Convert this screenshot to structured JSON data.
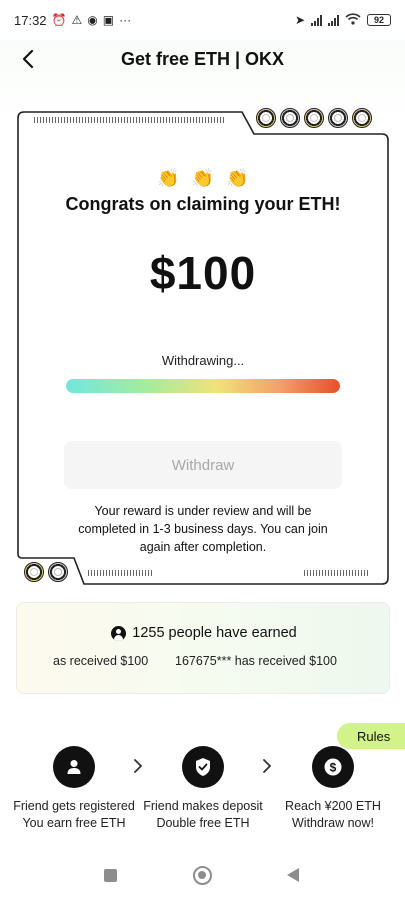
{
  "status_bar": {
    "time": "17:32",
    "icons_left": [
      "alarm-icon",
      "triangle-a-icon",
      "messenger-icon",
      "box-icon",
      "more-dots-icon"
    ],
    "battery": "92"
  },
  "header": {
    "title": "Get free ETH | OKX",
    "back_icon": "chevron-left-icon"
  },
  "card": {
    "claps": [
      "clap-icon",
      "clap-icon",
      "clap-icon"
    ],
    "congrats": "Congrats on claiming your ETH!",
    "amount": "$100",
    "withdrawing_label": "Withdrawing...",
    "progress": 1.0,
    "withdraw_button": "Withdraw",
    "review_text": "Your reward is under review and will be completed in 1-3 business days. You can join again after completion."
  },
  "earned": {
    "headline": "1255 people have earned",
    "ticker": [
      "as received $100",
      "167675*** has received $100"
    ]
  },
  "rules_label": "Rules",
  "steps": [
    {
      "icon": "user-icon",
      "text": "Friend gets registered You earn free ETH"
    },
    {
      "icon": "shield-check-icon",
      "text": "Friend makes deposit Double free ETH"
    },
    {
      "icon": "dollar-coin-icon",
      "text": "Reach ¥200 ETH Withdraw now!"
    }
  ],
  "colors": {
    "accent_green": "#d2f38a",
    "progress_start": "#72e6dd",
    "progress_end": "#e6502a",
    "coin_gold": "#e0d27a"
  }
}
